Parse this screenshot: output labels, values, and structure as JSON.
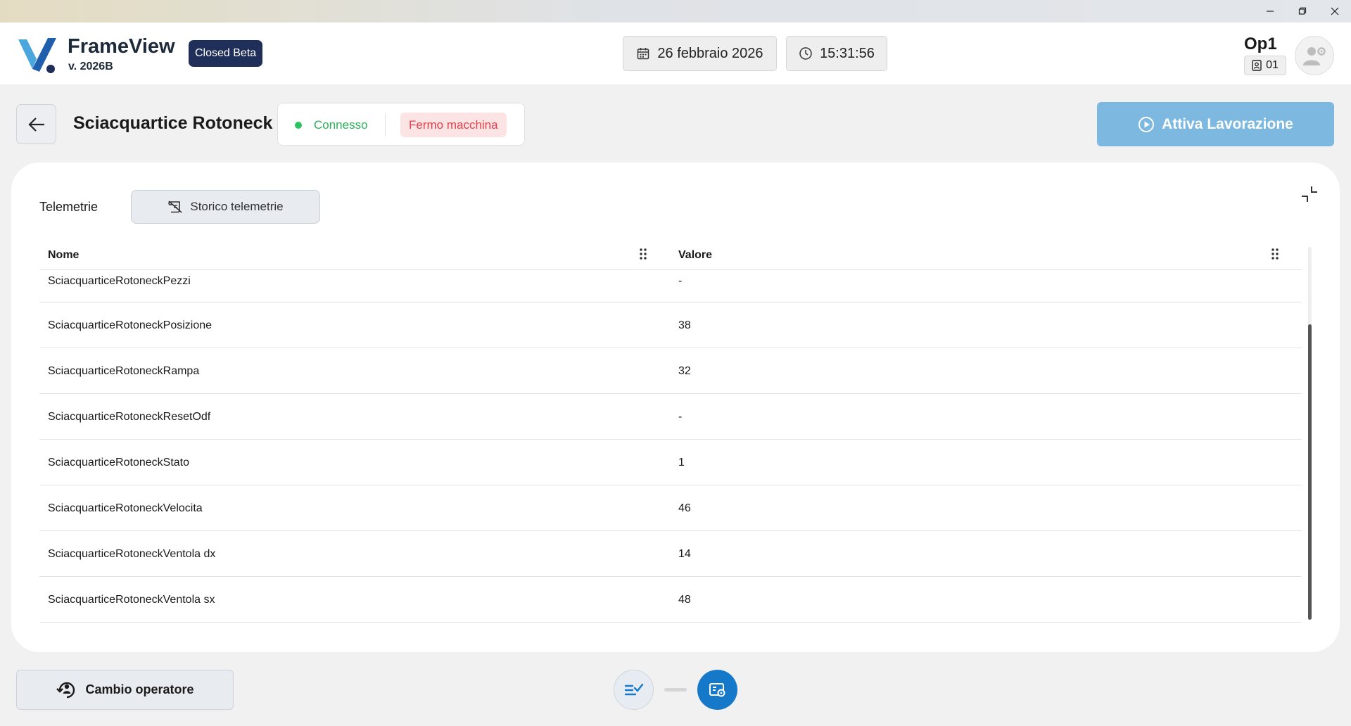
{
  "app": {
    "name": "FrameView",
    "version": "v. 2026B",
    "badge": "Closed Beta"
  },
  "header": {
    "date": "26 febbraio 2026",
    "time": "15:31:56",
    "operator_name": "Op1",
    "operator_id": "01"
  },
  "machine": {
    "title": "Sciacquartice Rotoneck",
    "status_connected": "Connesso",
    "status_state": "Fermo macchina",
    "start_label": "Attiva Lavorazione"
  },
  "tabs": {
    "telemetry_label": "Telemetrie",
    "history_label": "Storico telemetrie"
  },
  "table": {
    "columns": {
      "name": "Nome",
      "value": "Valore"
    },
    "rows": [
      {
        "name": "SciacquarticeRotoneckPezzi",
        "value": "-"
      },
      {
        "name": "SciacquarticeRotoneckPosizione",
        "value": "38"
      },
      {
        "name": "SciacquarticeRotoneckRampa",
        "value": "32"
      },
      {
        "name": "SciacquarticeRotoneckResetOdf",
        "value": "-"
      },
      {
        "name": "SciacquarticeRotoneckStato",
        "value": "1"
      },
      {
        "name": "SciacquarticeRotoneckVelocita",
        "value": "46"
      },
      {
        "name": "SciacquarticeRotoneckVentola dx",
        "value": "14"
      },
      {
        "name": "SciacquarticeRotoneckVentola sx",
        "value": "48"
      }
    ]
  },
  "footer": {
    "operator_change_label": "Cambio operatore"
  },
  "colors": {
    "brand_navy": "#1f2f5a",
    "primary_blue": "#1678c8",
    "start_disabled": "#7db8e0",
    "connected_green": "#2bb05a",
    "stop_red": "#e0414b"
  },
  "icons": {
    "minimize": "minimize-icon",
    "maximize": "restore-icon",
    "close": "close-icon",
    "calendar": "calendar-icon",
    "clock": "clock-icon",
    "badge": "id-badge-icon",
    "avatar": "user-gear-icon",
    "back": "arrow-left-icon",
    "play": "play-circle-icon",
    "history": "history-scroll-icon",
    "collapse": "collapse-icon",
    "column_menu": "drag-handle-icon",
    "operator": "user-switch-icon",
    "checklist": "checklist-icon",
    "telemetry": "telemetry-settings-icon"
  }
}
